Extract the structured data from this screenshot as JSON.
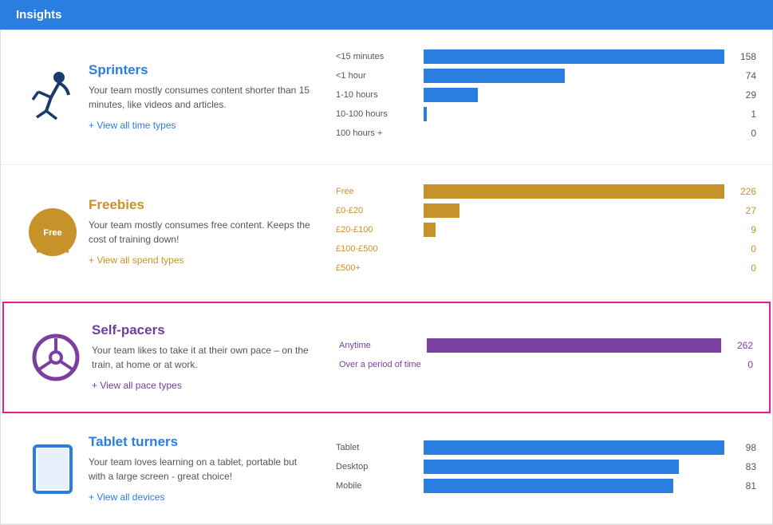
{
  "header": {
    "title": "Insights"
  },
  "sections": [
    {
      "id": "sprinters",
      "title": "Sprinters",
      "title_color": "blue",
      "description": "Your team mostly consumes content shorter than 15 minutes, like videos and articles.",
      "link_text": "+ View all time types",
      "link_color": "blue",
      "highlighted": false,
      "bars": [
        {
          "label": "<15 minutes",
          "label_color": "neutral",
          "value": 158,
          "max": 226,
          "color": "blue"
        },
        {
          "label": "<1 hour",
          "label_color": "neutral",
          "value": 74,
          "max": 226,
          "color": "blue"
        },
        {
          "label": "1-10 hours",
          "label_color": "neutral",
          "value": 29,
          "max": 226,
          "color": "blue"
        },
        {
          "label": "10-100 hours",
          "label_color": "neutral",
          "value": 1,
          "max": 226,
          "color": "blue"
        },
        {
          "label": "100 hours +",
          "label_color": "neutral",
          "value": 0,
          "max": 226,
          "color": "blue"
        }
      ]
    },
    {
      "id": "freebies",
      "title": "Freebies",
      "title_color": "gold",
      "description": "Your team mostly consumes free content. Keeps the cost of training down!",
      "link_text": "+ View all spend types",
      "link_color": "gold",
      "highlighted": false,
      "bars": [
        {
          "label": "Free",
          "label_color": "gold",
          "value": 226,
          "max": 226,
          "color": "gold"
        },
        {
          "label": "£0-£20",
          "label_color": "gold",
          "value": 27,
          "max": 226,
          "color": "gold"
        },
        {
          "label": "£20-£100",
          "label_color": "gold",
          "value": 9,
          "max": 226,
          "color": "gold"
        },
        {
          "label": "£100-£500",
          "label_color": "gold",
          "value": 0,
          "max": 226,
          "color": "gold"
        },
        {
          "label": "£500+",
          "label_color": "gold",
          "value": 0,
          "max": 226,
          "color": "gold"
        }
      ]
    },
    {
      "id": "self-pacers",
      "title": "Self-pacers",
      "title_color": "purple",
      "description": "Your team likes to take it at their own pace – on the train, at home or at work.",
      "link_text": "+ View all pace types",
      "link_color": "purple",
      "highlighted": true,
      "bars": [
        {
          "label": "Anytime",
          "label_color": "purple",
          "value": 262,
          "max": 262,
          "color": "purple"
        },
        {
          "label": "Over a period of time",
          "label_color": "purple",
          "value": 0,
          "max": 262,
          "color": "purple"
        }
      ]
    },
    {
      "id": "tablet-turners",
      "title": "Tablet turners",
      "title_color": "blue",
      "description": "Your team loves learning on a tablet, portable but with a large screen - great choice!",
      "link_text": "+ View all devices",
      "link_color": "blue",
      "highlighted": false,
      "bars": [
        {
          "label": "Tablet",
          "label_color": "neutral",
          "value": 98,
          "max": 98,
          "color": "blue"
        },
        {
          "label": "Desktop",
          "label_color": "neutral",
          "value": 83,
          "max": 98,
          "color": "blue"
        },
        {
          "label": "Mobile",
          "label_color": "neutral",
          "value": 81,
          "max": 98,
          "color": "blue"
        }
      ]
    }
  ]
}
